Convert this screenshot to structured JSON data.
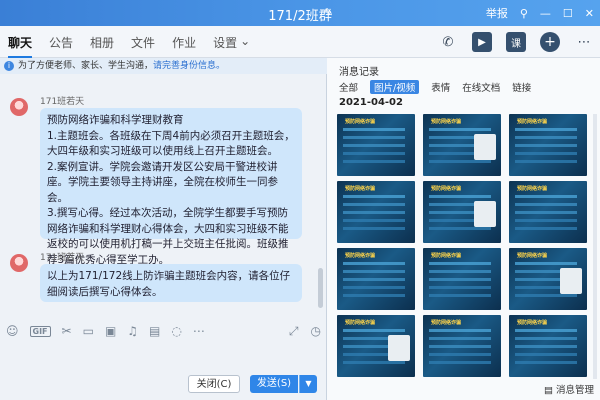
{
  "window": {
    "title": "171/2班群",
    "right_text": "举报"
  },
  "tabs": [
    "聊天",
    "公告",
    "相册",
    "文件",
    "作业",
    "设置"
  ],
  "notice": {
    "text": "为了方便老师、家长、学生沟通，",
    "link": "请完善身份信息。"
  },
  "messages": [
    {
      "sender": "171班若天",
      "lines": [
        "预防网络诈骗和科学理财教育",
        "1.主题班会。各班级在下周4前内必须召开主题班会，大四年级和实习班级可以使用线上召开主题班会。",
        "2.案例宣讲。学院会邀请开发区公安局干警进校讲座。学院主要领导主持讲座，全院在校师生一同参会。",
        "3.撰写心得。经过本次活动，全院学生都要手写预防网络诈骗和科学理财心得体会，大四和实习班级不能返校的可以使用机打稿一并上交班主任批阅。班级推荐3篇优秀心得至学工办。"
      ]
    },
    {
      "sender": "171班若天",
      "lines": [
        "以上为171/172线上防诈骗主题班会内容，请各位仔细阅读后撰写心得体会。"
      ]
    }
  ],
  "input": {
    "close_label": "关闭(C)",
    "send_label": "发送(S)"
  },
  "records": {
    "title": "消息记录",
    "tabs": [
      "全部",
      "图片/视频",
      "表情",
      "在线文档",
      "链接"
    ],
    "active_tab": "图片/视频",
    "date": "2021-04-02",
    "thumb_caption": "预防网络诈骗",
    "bottom_label": "消息管理"
  }
}
